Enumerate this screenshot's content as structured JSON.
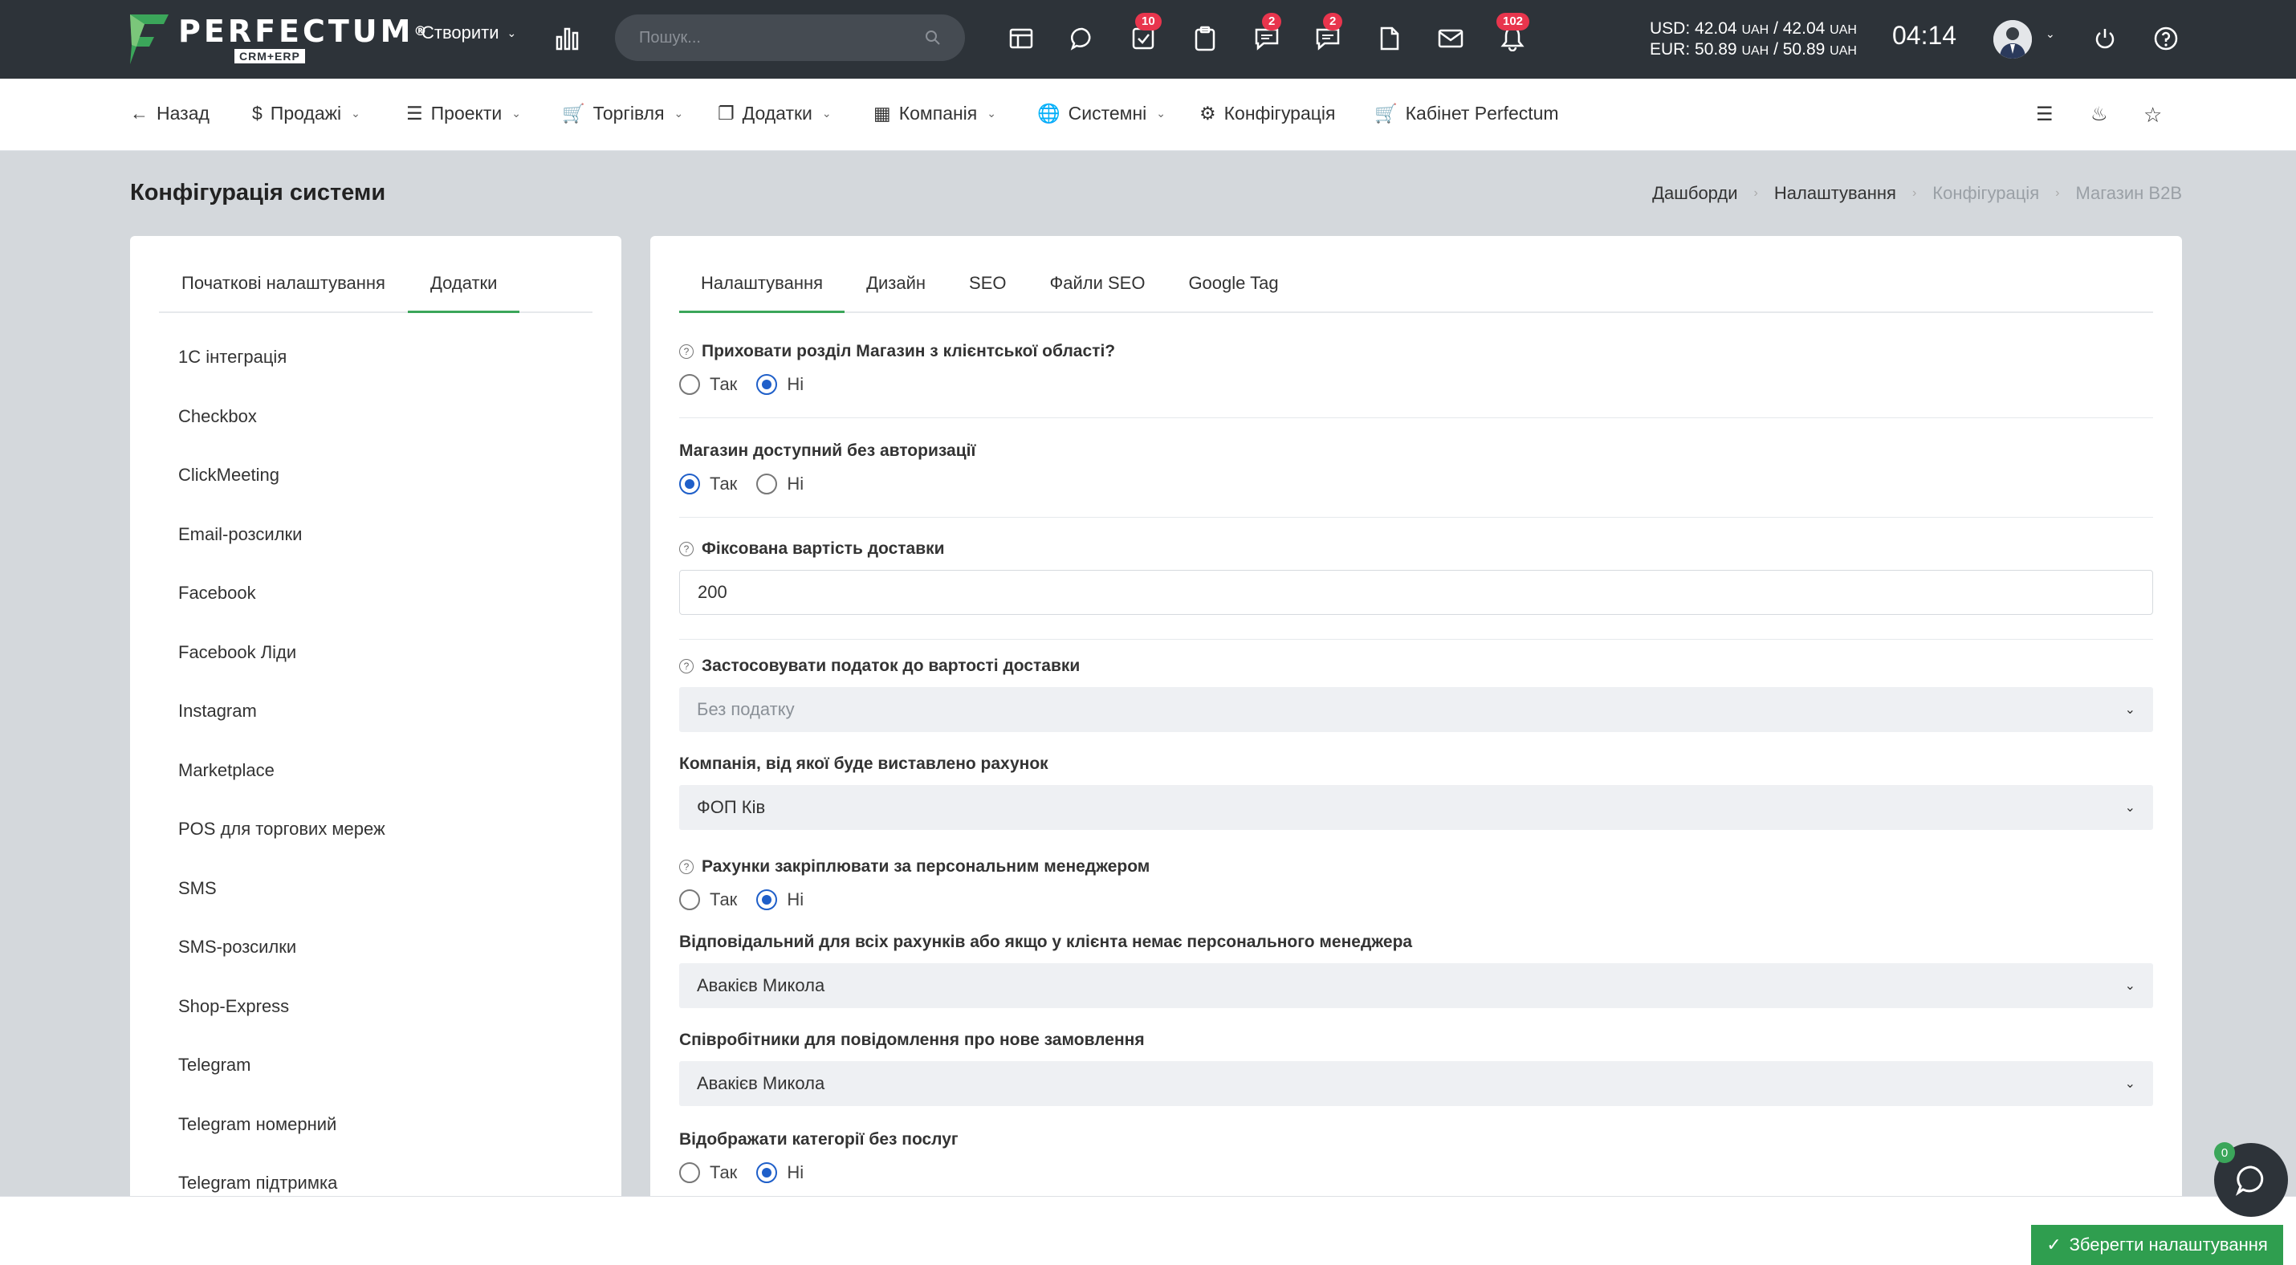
{
  "topbar": {
    "logo_title": "PERFECTUM",
    "logo_reg": "®",
    "logo_sub": "CRM+ERP",
    "create_label": "Створити",
    "search_placeholder": "Пошук...",
    "badges": {
      "tasks": "10",
      "chat": "2",
      "messages": "2",
      "notifications": "102"
    },
    "currency_usd_label": "USD:",
    "currency_usd": "42.04",
    "currency_usd_sep": "/",
    "currency_usd2": "42.04",
    "currency_eur_label": "EUR:",
    "currency_eur": "50.89",
    "currency_eur2": "50.89",
    "currency_unit": "UAH",
    "time": "04:14"
  },
  "subnav": {
    "back": "Назад",
    "sales": "Продажі",
    "projects": "Проекти",
    "trade": "Торгівля",
    "addons": "Додатки",
    "company": "Компанія",
    "system": "Системні",
    "config": "Конфігурація",
    "cabinet": "Кабінет Perfectum"
  },
  "page": {
    "title": "Конфігурація системи",
    "breadcrumb": [
      "Дашборди",
      "Налаштування",
      "Конфігурація",
      "Магазин B2B"
    ]
  },
  "left": {
    "tabs": [
      "Початкові налаштування",
      "Додатки"
    ],
    "menu": [
      "1С інтеграція",
      "Checkbox",
      "ClickMeeting",
      "Email-розсилки",
      "Facebook",
      "Facebook Ліди",
      "Instagram",
      "Marketplace",
      "POS для торгових мереж",
      "SMS",
      "SMS-розсилки",
      "Shop-Express",
      "Telegram",
      "Telegram номерний",
      "Telegram підтримка"
    ]
  },
  "right": {
    "tabs": [
      "Налаштування",
      "Дизайн",
      "SEO",
      "Файли SEO",
      "Google Tag"
    ],
    "yes": "Так",
    "no": "Ні",
    "f1_label": "Приховати розділ Магазин з клієнтської області?",
    "f2_label": "Магазин доступний без авторизації",
    "f3_label": "Фіксована вартість доставки",
    "f3_value": "200",
    "f4_label": "Застосовувати податок до вартості доставки",
    "f4_value": "Без податку",
    "f5_label": "Компанія, від якої буде виставлено рахунок",
    "f5_value": "ФОП Ків",
    "f6_label": "Рахунки закріплювати за персональним менеджером",
    "f7_label": "Відповідальний для всіх рахунків або якщо у клієнта немає персонального менеджера",
    "f7_value": "Авакієв Микола",
    "f8_label": "Співробітники для повідомлення про нове замовлення",
    "f8_value": "Авакієв Микола",
    "f9_label": "Відображати категорії без послуг"
  },
  "bottom": {
    "save": "Зберегти налаштування",
    "chat_count": "0"
  },
  "colors": {
    "accent_green": "#3ba65a",
    "radio_blue": "#1f5fc9",
    "badge_red": "#e8354d",
    "topbar": "#2d3339"
  }
}
